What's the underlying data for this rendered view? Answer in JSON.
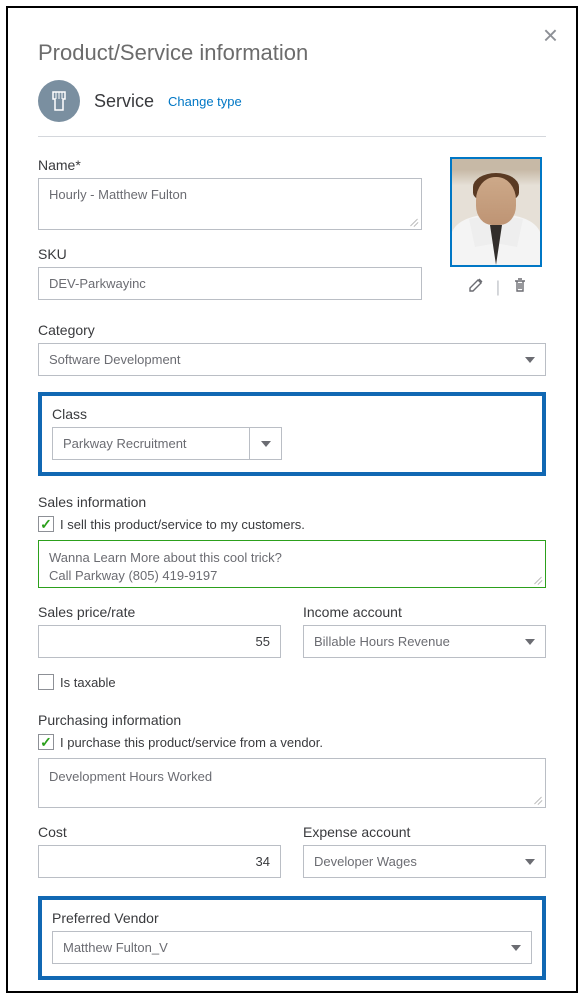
{
  "header": {
    "title": "Product/Service information",
    "service_label": "Service",
    "change_type": "Change type"
  },
  "name": {
    "label": "Name*",
    "value": "Hourly -  Matthew Fulton"
  },
  "sku": {
    "label": "SKU",
    "value": "DEV-Parkwayinc"
  },
  "category": {
    "label": "Category",
    "value": "Software Development"
  },
  "class": {
    "label": "Class",
    "value": "Parkway Recruitment"
  },
  "sales": {
    "section": "Sales information",
    "checkbox": "I sell this product/service to my customers.",
    "description": "Wanna Learn More about this cool trick?\nCall Parkway (805) 419-9197",
    "price_label": "Sales price/rate",
    "price_value": "55",
    "income_label": "Income account",
    "income_value": "Billable Hours Revenue",
    "taxable": "Is taxable"
  },
  "purchasing": {
    "section": "Purchasing information",
    "checkbox": "I purchase this product/service from a vendor.",
    "description": "Development Hours Worked",
    "cost_label": "Cost",
    "cost_value": "34",
    "expense_label": "Expense account",
    "expense_value": "Developer Wages"
  },
  "vendor": {
    "label": "Preferred Vendor",
    "value": "Matthew Fulton_V"
  }
}
